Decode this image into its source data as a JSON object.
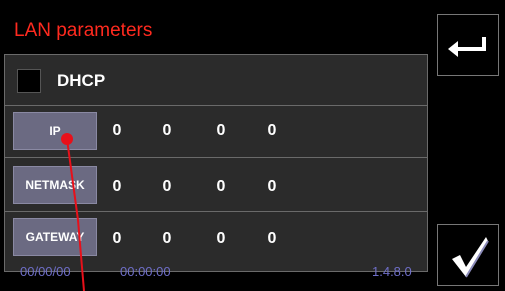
{
  "header": {
    "title": "LAN parameters"
  },
  "dhcp": {
    "label": "DHCP",
    "checked": false
  },
  "params": [
    {
      "label": "IP",
      "octets": [
        "0",
        "0",
        "0",
        "0"
      ]
    },
    {
      "label": "NETMASK",
      "octets": [
        "0",
        "0",
        "0",
        "0"
      ]
    },
    {
      "label": "GATEWAY",
      "octets": [
        "0",
        "0",
        "0",
        "0"
      ]
    }
  ],
  "status": {
    "date": "00/00/00",
    "time": "00:00:00",
    "version": "1.4.8.0"
  },
  "buttons": {
    "back_icon": "return-arrow-icon",
    "confirm_icon": "checkmark-icon"
  },
  "colors": {
    "title": "#ff2a1f",
    "status": "#6e6ec7",
    "button": "#6b6a82"
  }
}
